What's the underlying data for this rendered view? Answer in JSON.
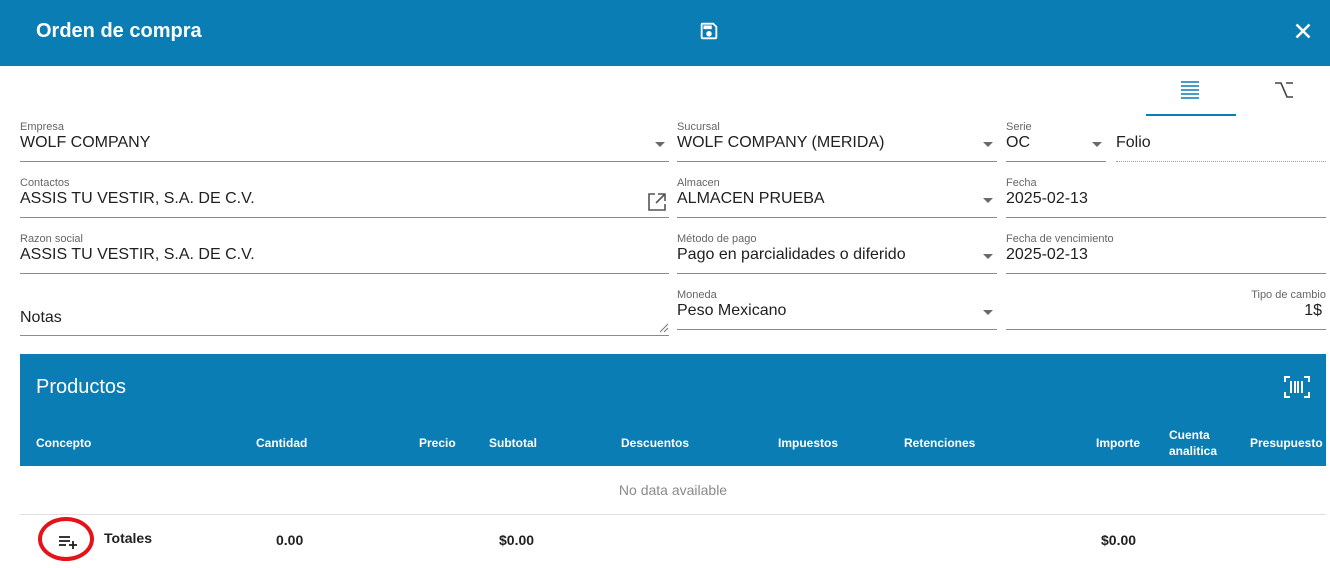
{
  "header": {
    "title": "Orden de compra"
  },
  "form": {
    "empresa": {
      "label": "Empresa",
      "value": "WOLF COMPANY"
    },
    "sucursal": {
      "label": "Sucursal",
      "value": "WOLF COMPANY (MERIDA)"
    },
    "serie": {
      "label": "Serie",
      "value": "OC"
    },
    "folio": {
      "placeholder": "Folio"
    },
    "contactos": {
      "label": "Contactos",
      "value": "ASSIS TU VESTIR, S.A. DE C.V."
    },
    "almacen": {
      "label": "Almacen",
      "value": "ALMACEN PRUEBA"
    },
    "fecha": {
      "label": "Fecha",
      "value": "2025-02-13"
    },
    "razon_social": {
      "label": "Razon social",
      "value": "ASSIS TU VESTIR, S.A. DE C.V."
    },
    "metodo_pago": {
      "label": "Método de pago",
      "value": "Pago en parcialidades o diferido"
    },
    "fecha_vencimiento": {
      "label": "Fecha de vencimiento",
      "value": "2025-02-13"
    },
    "notas": {
      "placeholder": "Notas"
    },
    "moneda": {
      "label": "Moneda",
      "value": "Peso Mexicano"
    },
    "tipo_cambio": {
      "label": "Tipo de cambio",
      "value": "1$"
    }
  },
  "products": {
    "title": "Productos",
    "columns": [
      "Concepto",
      "Cantidad",
      "Precio",
      "Subtotal",
      "Descuentos",
      "Impuestos",
      "Retenciones",
      "Importe",
      "Cuenta analítica",
      "Presupuesto"
    ],
    "column_lines": {
      "cuenta_1": "Cuenta",
      "cuenta_2": "analitica"
    },
    "empty_text": "No data available",
    "totals": {
      "label": "Totales",
      "cantidad": "0.00",
      "subtotal": "$0.00",
      "importe": "$0.00"
    }
  },
  "colors": {
    "primary": "#0a7db5",
    "highlight_circle": "#e5121a"
  },
  "icons": [
    "save-icon",
    "close-icon",
    "list-view-icon",
    "alt-view-icon",
    "external-link-icon",
    "barcode-scan-icon",
    "playlist-add-icon"
  ]
}
